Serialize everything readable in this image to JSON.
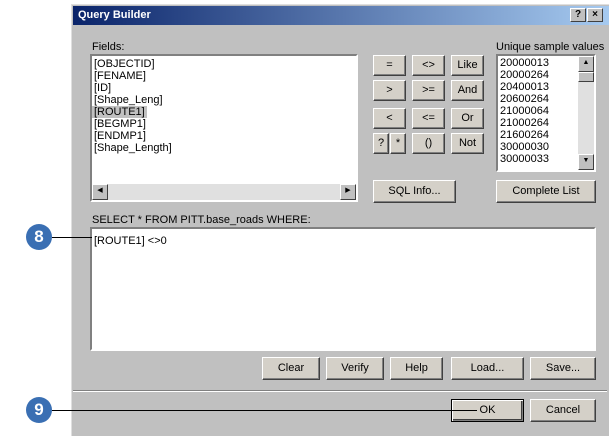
{
  "window": {
    "title": "Query Builder",
    "help_glyph": "?",
    "close_glyph": "×"
  },
  "fields": {
    "label": "Fields:",
    "items": [
      "[OBJECTID]",
      "[FENAME]",
      "[ID]",
      "[Shape_Leng]",
      "[ROUTE1]",
      "[BEGMP1]",
      "[ENDMP1]",
      "[Shape_Length]"
    ],
    "selected_index": 4
  },
  "operators": {
    "eq": "=",
    "ne": "<>",
    "like": "Like",
    "gt": ">",
    "ge": ">=",
    "and": "And",
    "lt": "<",
    "le": "<=",
    "or": "Or",
    "q": "?",
    "star": "*",
    "paren": "()",
    "not": "Not"
  },
  "samples": {
    "label": "Unique sample values",
    "items": [
      "20000013",
      "20000264",
      "20400013",
      "20600264",
      "21000064",
      "21000264",
      "21600264",
      "30000030",
      "30000033"
    ]
  },
  "buttons": {
    "sql_info": "SQL Info...",
    "complete_list": "Complete List",
    "clear": "Clear",
    "verify": "Verify",
    "help": "Help",
    "load": "Load...",
    "save": "Save...",
    "ok": "OK",
    "cancel": "Cancel"
  },
  "query": {
    "prefix": "SELECT * FROM PITT.base_roads WHERE:",
    "expression": "[ROUTE1] <>0"
  },
  "callouts": {
    "step8": "8",
    "step9": "9"
  },
  "colors": {
    "title_bar": "#0a246a",
    "callout": "#3a6fb3",
    "dialog_face": "#c0c0c0"
  }
}
